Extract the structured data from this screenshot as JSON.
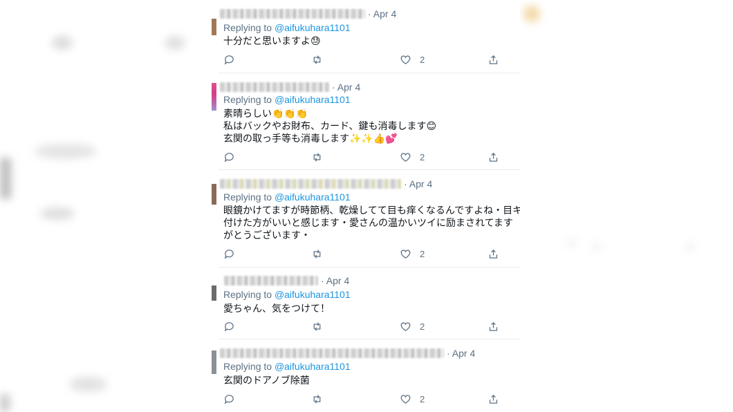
{
  "tweets": [
    {
      "date": "Apr 4",
      "replying_prefix": "Replying to",
      "handle": "@aifukuhara1101",
      "lines": [
        "十分だと思いますよ😓"
      ],
      "likes": "2",
      "avatar_color": "#a07858"
    },
    {
      "date": "Apr 4",
      "replying_prefix": "Replying to",
      "handle": "@aifukuhara1101",
      "lines": [
        "素晴らしい👏👏👏",
        "私はバックやお財布、カード、鍵も消毒します😊",
        "玄関の取っ手等も消毒します✨✨👍💕"
      ],
      "likes": "2",
      "avatar_color": "#e0508f"
    },
    {
      "date": "Apr 4",
      "replying_prefix": "Replying to",
      "handle": "@aifukuhara1101",
      "lines": [
        "眼鏡かけてますが時節柄、乾燥してて目も痒くなるんですよね・目キ",
        "付けた方がいいと感じます・愛さんの温かいツイに励まされてます",
        "がとうございます・"
      ],
      "likes": "2",
      "avatar_color": "#8a6a58"
    },
    {
      "date": "Apr 4",
      "replying_prefix": "Replying to",
      "handle": "@aifukuhara1101",
      "lines": [
        "愛ちゃん、気をつけて！"
      ],
      "likes": "2",
      "avatar_color": "#6b6b6b"
    },
    {
      "date": "Apr 4",
      "replying_prefix": "Replying to",
      "handle": "@aifukuhara1101",
      "lines": [
        "玄関のドアノブ除菌"
      ],
      "likes": "2",
      "avatar_color": "#8a9098"
    }
  ],
  "icons": {
    "reply": "reply-icon",
    "retweet": "retweet-icon",
    "like": "like-icon",
    "share": "share-icon"
  },
  "colors": {
    "link": "#1b95e0",
    "secondary": "#5b7083",
    "divider": "#e6ecf0"
  }
}
